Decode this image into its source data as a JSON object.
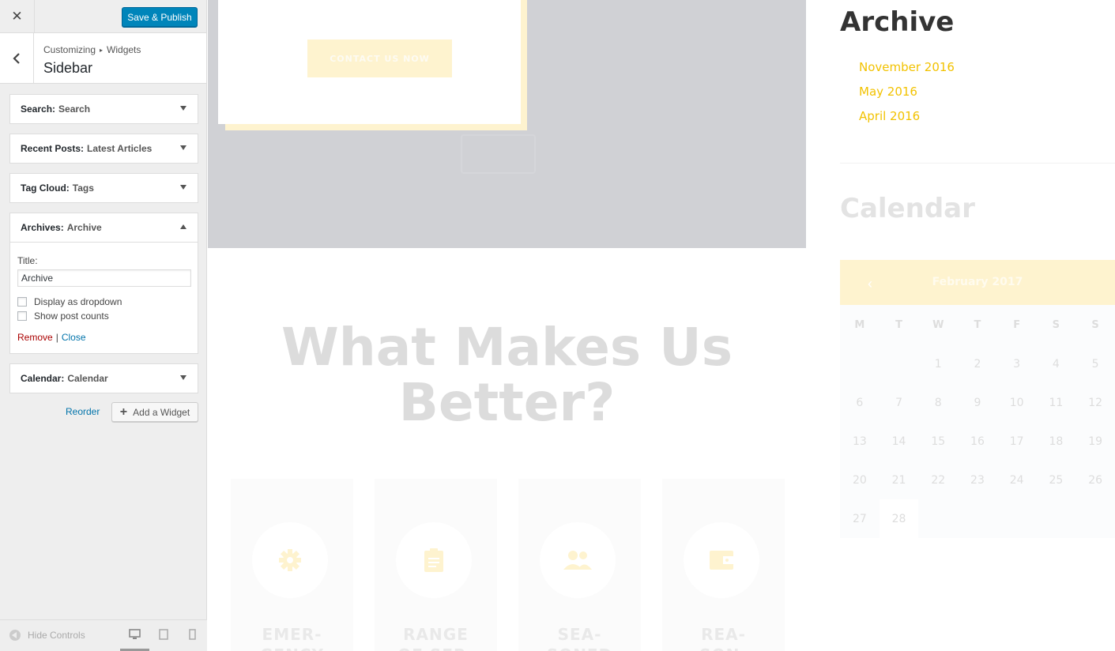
{
  "customizer": {
    "close_glyph": "✕",
    "publish_label": "Save & Publish",
    "breadcrumb": [
      "Customizing",
      "Widgets"
    ],
    "breadcrumb_sep": "▸",
    "section_title": "Sidebar",
    "widgets": [
      {
        "type": "Search:",
        "title": "Search",
        "expanded": false
      },
      {
        "type": "Recent Posts:",
        "title": "Latest Articles",
        "expanded": false
      },
      {
        "type": "Tag Cloud:",
        "title": "Tags",
        "expanded": false
      },
      {
        "type": "Archives:",
        "title": "Archive",
        "expanded": true
      },
      {
        "type": "Calendar:",
        "title": "Calendar",
        "expanded": false
      }
    ],
    "archive_form": {
      "title_label": "Title:",
      "title_value": "Archive",
      "dropdown_label": "Display as dropdown",
      "dropdown_checked": false,
      "counts_label": "Show post counts",
      "counts_checked": false,
      "remove_label": "Remove",
      "separator": "|",
      "close_label": "Close"
    },
    "reorder_label": "Reorder",
    "add_widget_label": "Add a Widget",
    "hide_controls_label": "Hide Controls",
    "devices": [
      "desktop-icon",
      "tablet-icon",
      "mobile-icon"
    ],
    "active_device": "desktop"
  },
  "preview": {
    "hero_button": "CONTACT US NOW",
    "makes_title_line1": "What Makes Us",
    "makes_title_line2": "Better?",
    "features": [
      {
        "icon": "gear-icon",
        "line1": "EMER-",
        "line2": "GENCY"
      },
      {
        "icon": "clipboard-icon",
        "line1": "RANGE",
        "line2": "OF SER-"
      },
      {
        "icon": "people-icon",
        "line1": "SEA-",
        "line2": "SONED"
      },
      {
        "icon": "wallet-icon",
        "line1": "REA-",
        "line2": "SON-"
      }
    ],
    "sidebar": {
      "archive_title": "Archive",
      "archive_links": [
        "November 2016",
        "May 2016",
        "April 2016"
      ],
      "calendar_title": "Calendar",
      "calendar": {
        "prev_glyph": "‹",
        "month": "February 2017",
        "weekdays": [
          "M",
          "T",
          "W",
          "T",
          "F",
          "S",
          "S"
        ],
        "weeks": [
          [
            "",
            "",
            "1",
            "2",
            "3",
            "4",
            "5"
          ],
          [
            "6",
            "7",
            "8",
            "9",
            "10",
            "11",
            "12"
          ],
          [
            "13",
            "14",
            "15",
            "16",
            "17",
            "18",
            "19"
          ],
          [
            "20",
            "21",
            "22",
            "23",
            "24",
            "25",
            "26"
          ],
          [
            "27",
            "28",
            "",
            "",
            "",
            "",
            ""
          ]
        ]
      }
    },
    "colors": {
      "accent_yellow": "#f2c200",
      "faded_yellow": "#fef3cf",
      "publish_blue": "#0085ba",
      "link_blue": "#0073aa",
      "remove_red": "#aa0000"
    }
  }
}
